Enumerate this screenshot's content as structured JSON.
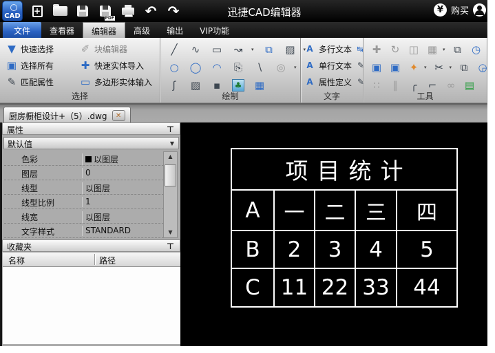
{
  "window": {
    "title": "迅捷CAD编辑器"
  },
  "titlebar": {
    "logo": "CAD",
    "buy_label": "购买",
    "yen": "¥",
    "pdf_tag": "PDF",
    "new_plus": "+",
    "undo": "↶",
    "redo": "↷"
  },
  "menu": {
    "tabs": [
      "文件",
      "查看器",
      "编辑器",
      "高级",
      "输出",
      "VIP功能"
    ]
  },
  "ribbon": {
    "select_group": {
      "label": "选择",
      "buttons": [
        "快速选择",
        "选择所有",
        "匹配属性",
        "块编辑器",
        "快速实体导入",
        "多边形实体输入"
      ]
    },
    "draw_group": {
      "label": "绘制"
    },
    "text_group": {
      "label": "文字",
      "buttons": [
        "多行文本",
        "单行文本",
        "属性定义"
      ]
    },
    "tools_group": {
      "label": "工具"
    }
  },
  "icons": {
    "quick_select": "▼",
    "select_all": "▣",
    "match_props": "✎",
    "block_editor": "✐",
    "entity_import": "✚",
    "polygon_input": "▭",
    "line": "╱",
    "sketch": "∿",
    "rectangle": "▭",
    "polyline": "↝",
    "copy_entity": "⧉",
    "wipeout": "▨",
    "circle": "○",
    "ellipse": "◯",
    "arc": "◠",
    "copy_sheet": "⎘",
    "thick_line": "∖",
    "blend": "◎",
    "revcloud": "ʃ",
    "hatch": "▨",
    "point": "▪",
    "image": "♣",
    "table": "▦",
    "mtext": "A",
    "stext": "A",
    "attrdef": "A",
    "spacing": "↹",
    "text_edit": "✎",
    "note_edit": "✎",
    "move": "✚",
    "rotate": "↻",
    "mirror": "◫",
    "array": "▦",
    "copy_stack": "⧉",
    "copy_time": "◷",
    "paste": "▣",
    "paste2": "▣",
    "spray": "✦",
    "scissors": "✂",
    "copy_stack2": "⧉",
    "copy_time2": "◶",
    "dots": "∷",
    "offset": "∥",
    "fillet": "╭",
    "chamfer": "⌐",
    "rings": "∞",
    "book_add": "▤",
    "pin": "⊤",
    "dropdown_arrow": "▼",
    "close_x": "✕",
    "scroll_up": "▲",
    "scroll_down": "▼"
  },
  "document_tab": {
    "title": "厨房橱柜设计+（5）.dwg"
  },
  "properties_panel": {
    "title": "属性",
    "preset": "默认值",
    "rows": [
      {
        "label": "色彩",
        "value": "以图层"
      },
      {
        "label": "图层",
        "value": "0"
      },
      {
        "label": "线型",
        "value": "以图层"
      },
      {
        "label": "线型比例",
        "value": "1"
      },
      {
        "label": "线宽",
        "value": "以图层"
      },
      {
        "label": "文字样式",
        "value": "STANDARD"
      }
    ]
  },
  "favorites_panel": {
    "title": "收藏夹",
    "columns": [
      "名称",
      "路径"
    ]
  },
  "canvas": {
    "cad_table": {
      "title": "项目统计",
      "rows": [
        [
          "A",
          "一",
          "二",
          "三",
          "四"
        ],
        [
          "B",
          "2",
          "3",
          "4",
          "5"
        ],
        [
          "C",
          "11",
          "22",
          "33",
          "44"
        ]
      ]
    }
  },
  "colors": {
    "accent_blue": "#2e6bc4",
    "canvas_bg": "#000000",
    "table_line": "#ffffff",
    "close_x": "#b06a28"
  }
}
